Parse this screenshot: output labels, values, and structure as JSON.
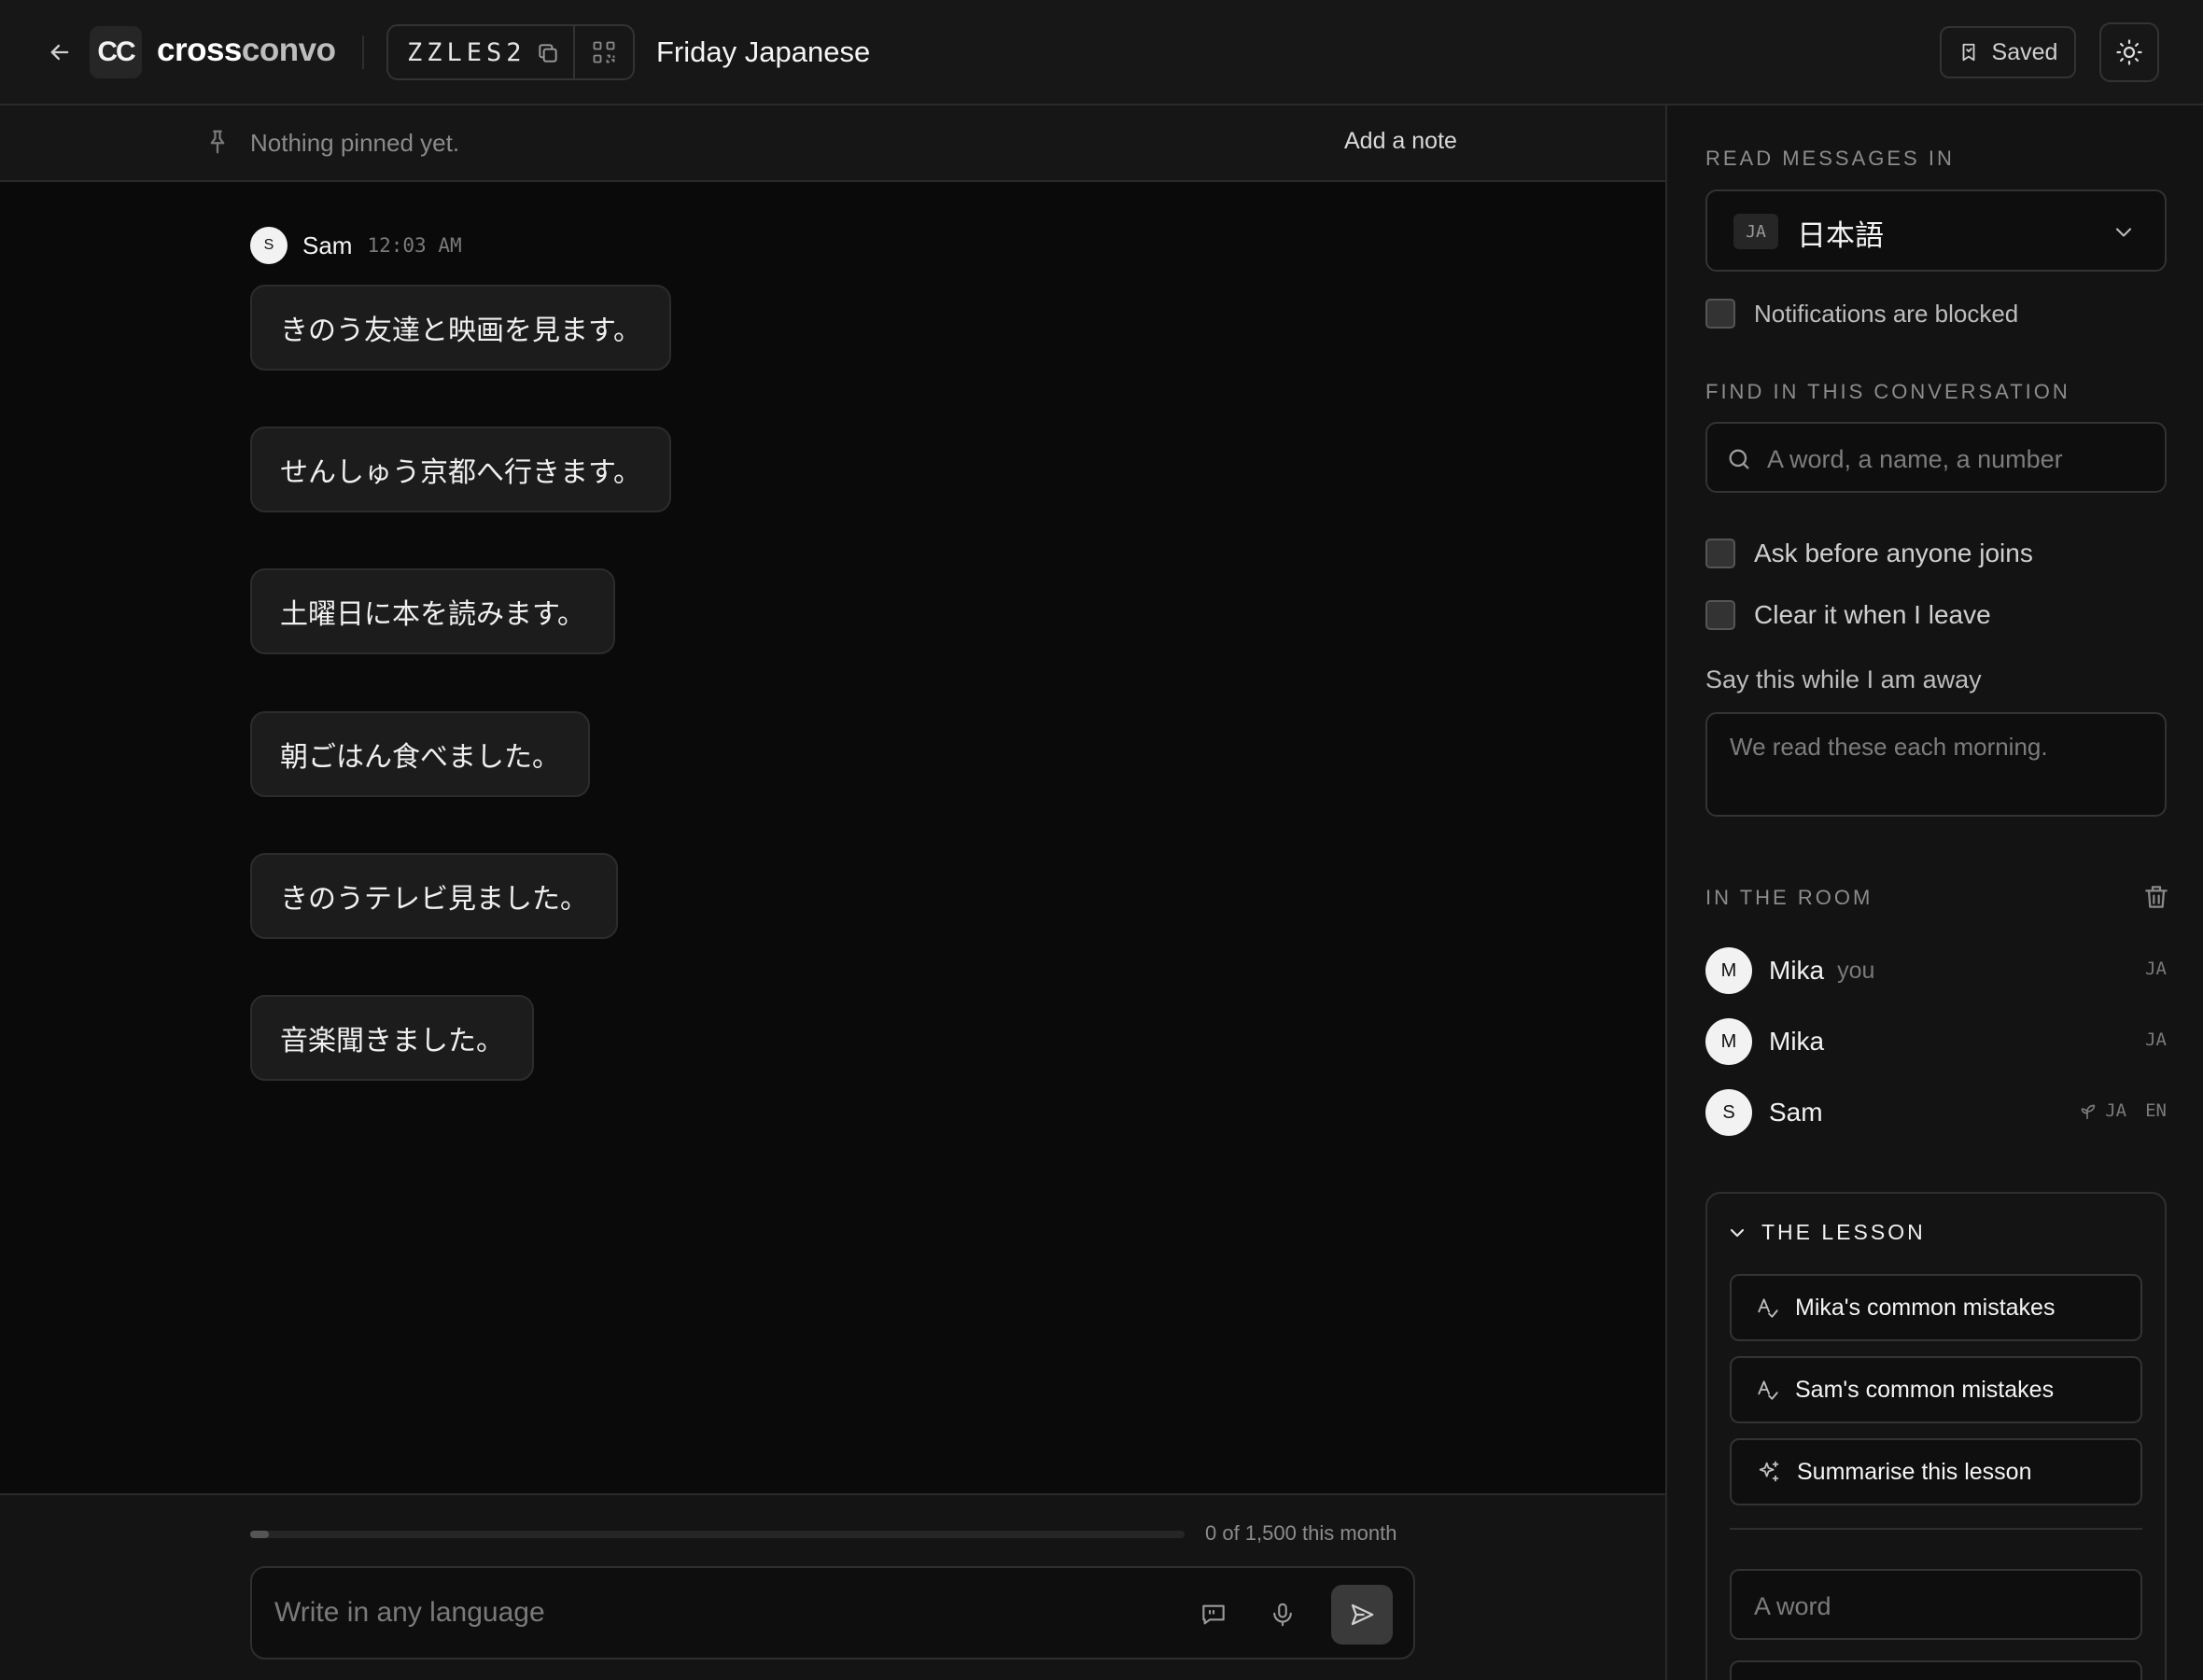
{
  "header": {
    "brand_part1": "cross",
    "brand_part2": "convo",
    "logo_text": "CC",
    "room_code": "ZZLES2",
    "room_title": "Friday Japanese",
    "saved_label": "Saved"
  },
  "pinned": {
    "empty_text": "Nothing pinned yet.",
    "add_note_label": "Add a note"
  },
  "conversation": {
    "author": "Sam",
    "author_initial": "S",
    "time": "12:03 AM",
    "messages": [
      "きのう友達と映画を見ます。",
      "せんしゅう京都へ行きます。",
      "土曜日に本を読みます。",
      "朝ごはん食べました。",
      "きのうテレビ見ました。",
      "音楽聞きました。"
    ]
  },
  "composer": {
    "usage_text": "0 of 1,500 this month",
    "usage_fraction": 0.02,
    "placeholder": "Write in any language"
  },
  "panel": {
    "read_label": "READ MESSAGES IN",
    "language_code": "JA",
    "language_name": "日本語",
    "notifications_label": "Notifications are blocked",
    "find_label": "FIND IN THIS CONVERSATION",
    "search_placeholder": "A word, a name, a number",
    "ask_label": "Ask before anyone joins",
    "clear_label": "Clear it when I leave",
    "away_label": "Say this while I am away",
    "away_placeholder": "We read these each morning.",
    "room_label": "IN THE ROOM",
    "members": [
      {
        "initial": "M",
        "name": "Mika",
        "you": "you",
        "langs": [
          "JA"
        ]
      },
      {
        "initial": "M",
        "name": "Mika",
        "you": "",
        "langs": [
          "JA"
        ]
      },
      {
        "initial": "S",
        "name": "Sam",
        "you": "",
        "langs": [
          "JA",
          "EN"
        ]
      }
    ],
    "lesson": {
      "title": "THE LESSON",
      "btn_mika": "Mika's common mistakes",
      "btn_sam": "Sam's common mistakes",
      "btn_summary": "Summarise this lesson",
      "word_placeholder": "A word"
    }
  }
}
